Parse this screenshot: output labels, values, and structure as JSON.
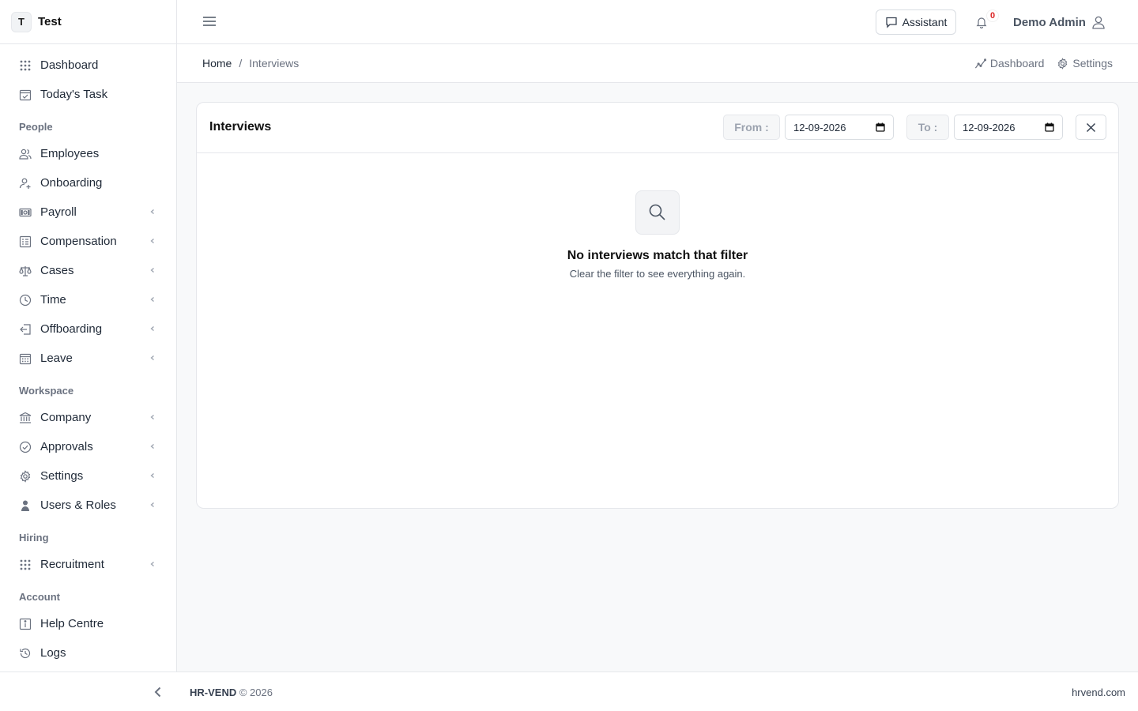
{
  "brand": {
    "initial": "T",
    "name": "Test"
  },
  "sidebar": {
    "top_items": [
      {
        "label": "Dashboard",
        "icon": "grid-icon"
      },
      {
        "label": "Today's Task",
        "icon": "calendar-check-icon"
      }
    ],
    "sections": [
      {
        "label": "People",
        "items": [
          {
            "label": "Employees",
            "icon": "users-icon",
            "expandable": false
          },
          {
            "label": "Onboarding",
            "icon": "user-plus-icon",
            "expandable": false
          },
          {
            "label": "Payroll",
            "icon": "money-icon",
            "expandable": true
          },
          {
            "label": "Compensation",
            "icon": "list-icon",
            "expandable": true
          },
          {
            "label": "Cases",
            "icon": "scale-icon",
            "expandable": true
          },
          {
            "label": "Time",
            "icon": "clock-icon",
            "expandable": true
          },
          {
            "label": "Offboarding",
            "icon": "exit-icon",
            "expandable": true
          },
          {
            "label": "Leave",
            "icon": "calendar-icon",
            "expandable": true
          }
        ]
      },
      {
        "label": "Workspace",
        "items": [
          {
            "label": "Company",
            "icon": "bank-icon",
            "expandable": true
          },
          {
            "label": "Approvals",
            "icon": "check-circle-icon",
            "expandable": true
          },
          {
            "label": "Settings",
            "icon": "gear-icon",
            "expandable": true
          },
          {
            "label": "Users & Roles",
            "icon": "user-shield-icon",
            "expandable": true
          }
        ]
      },
      {
        "label": "Hiring",
        "items": [
          {
            "label": "Recruitment",
            "icon": "grid-icon",
            "expandable": true
          }
        ]
      },
      {
        "label": "Account",
        "items": [
          {
            "label": "Help Centre",
            "icon": "info-icon",
            "expandable": false
          },
          {
            "label": "Logs",
            "icon": "history-icon",
            "expandable": false
          }
        ]
      }
    ]
  },
  "topbar": {
    "assistant_label": "Assistant",
    "notification_count": "0",
    "user_name": "Demo Admin"
  },
  "breadcrumb": {
    "home": "Home",
    "separator": "/",
    "current": "Interviews"
  },
  "quick_links": {
    "dashboard": "Dashboard",
    "settings": "Settings"
  },
  "card": {
    "title": "Interviews",
    "from_label": "From :",
    "from_value": "12-09-2026",
    "to_label": "To :",
    "to_value": "12-09-2026"
  },
  "empty_state": {
    "title": "No interviews match that filter",
    "subtitle": "Clear the filter to see everything again."
  },
  "footer": {
    "brand": "HR-VEND",
    "copyright": "© 2026",
    "site": "hrvend.com"
  },
  "colors": {
    "accent": "#1f2937",
    "badge": "#dc2626",
    "background": "#f8f9fa"
  }
}
